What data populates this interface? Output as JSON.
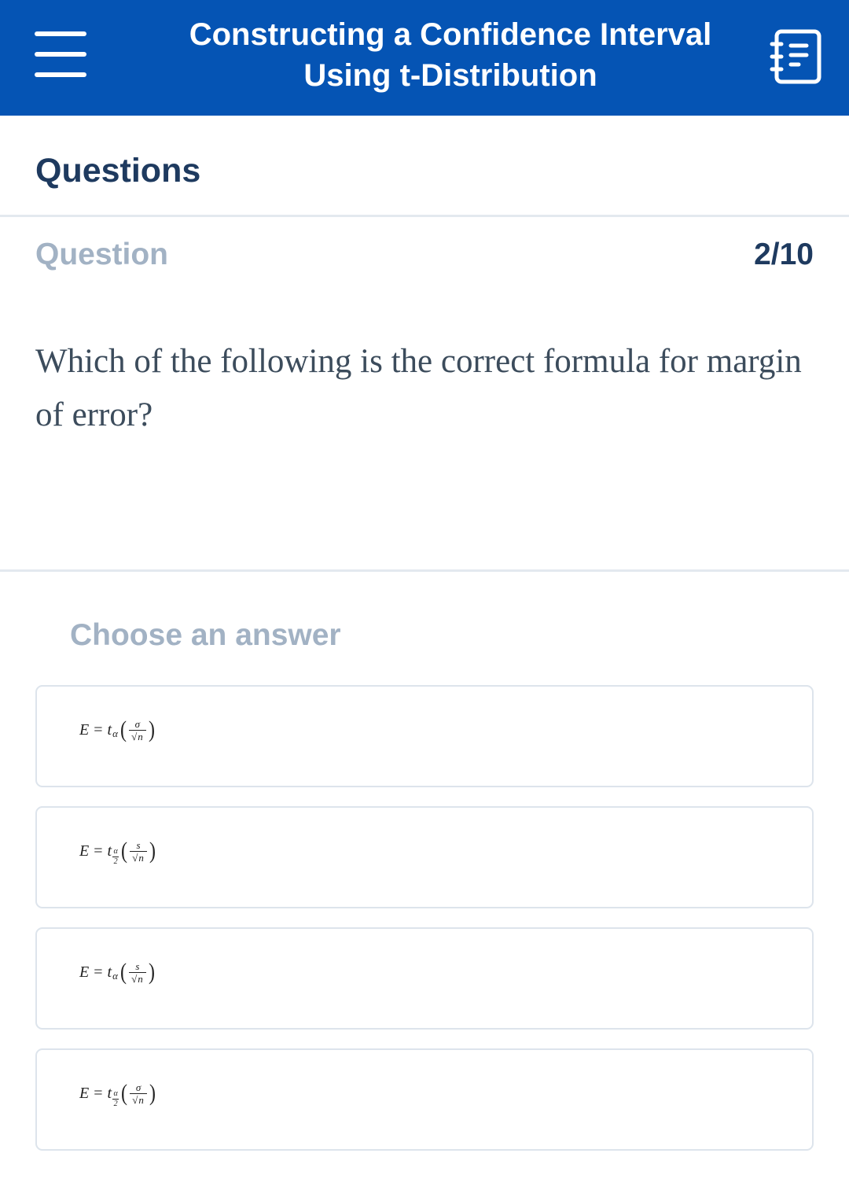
{
  "header": {
    "title_line1": "Constructing a Confidence Interval",
    "title_line2": "Using t-Distribution",
    "menu_icon": "hamburger-menu-icon",
    "notes_icon": "notebook-icon"
  },
  "section": {
    "heading": "Questions"
  },
  "question": {
    "label": "Question",
    "counter": "2/10",
    "text": "Which of the following is the correct formula for margin of error?"
  },
  "answers": {
    "prompt": "Choose an answer",
    "options": [
      {
        "lhs": "E",
        "eq": "=",
        "t": "t",
        "sub": "α",
        "sub_den": "",
        "num": "σ",
        "den": "n"
      },
      {
        "lhs": "E",
        "eq": "=",
        "t": "t",
        "sub": "α",
        "sub_den": "2",
        "num": "s",
        "den": "n"
      },
      {
        "lhs": "E",
        "eq": "=",
        "t": "t",
        "sub": "α",
        "sub_den": "",
        "num": "s",
        "den": "n"
      },
      {
        "lhs": "E",
        "eq": "=",
        "t": "t",
        "sub": "α",
        "sub_den": "2",
        "num": "σ",
        "den": "n"
      }
    ]
  },
  "colors": {
    "header_bg": "#0554b4",
    "heading_text": "#1e3a5f",
    "muted_text": "#a2b2c4",
    "border": "#dde4ec"
  }
}
